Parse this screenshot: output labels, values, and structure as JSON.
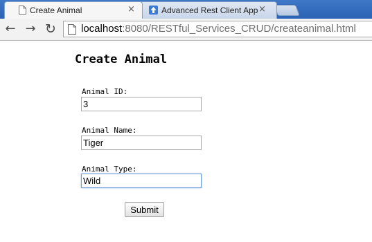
{
  "browser": {
    "tabs": [
      {
        "title": "Create Animal",
        "icon": "page-icon",
        "close": "×",
        "active": true
      },
      {
        "title": "Advanced Rest Client App",
        "icon": "upload-arrow-icon",
        "close": "×",
        "active": false
      }
    ],
    "toolbar": {
      "back_icon": "←",
      "forward_icon": "→",
      "reload_icon": "↻"
    },
    "address_bar": {
      "host": "localhost",
      "path": ":8080/RESTful_Services_CRUD/createanimal.html"
    }
  },
  "page": {
    "title": "Create Animal",
    "form": {
      "fields": [
        {
          "label": "Animal ID:",
          "value": "3"
        },
        {
          "label": "Animal Name:",
          "value": "Tiger"
        },
        {
          "label": "Animal Type:",
          "value": "Wild"
        }
      ],
      "submit_label": "Submit"
    }
  },
  "colors": {
    "tabstrip": "#2a62b4",
    "focus_ring": "#6f9ed8"
  }
}
